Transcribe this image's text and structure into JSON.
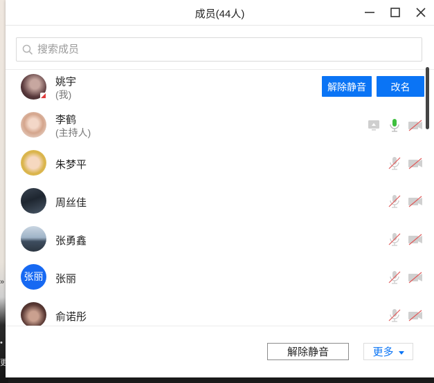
{
  "window": {
    "title": "成员(44人)",
    "controls": [
      "minimize-icon",
      "maximize-icon",
      "close-icon"
    ]
  },
  "search": {
    "placeholder": "搜索成员",
    "value": "",
    "icon": "search-icon"
  },
  "members": [
    {
      "name": "姚宇",
      "role": "(我)",
      "avatar": "photo",
      "actions": [
        "解除静音",
        "改名"
      ]
    },
    {
      "name": "李鹤",
      "role": "(主持人)",
      "avatar": "photo",
      "mic": "on",
      "camera": "off",
      "screen_share": true
    },
    {
      "name": "朱梦平",
      "avatar": "photo",
      "mic": "muted",
      "camera": "off"
    },
    {
      "name": "周丝佳",
      "avatar": "photo",
      "mic": "muted",
      "camera": "off"
    },
    {
      "name": "张勇鑫",
      "avatar": "photo",
      "mic": "muted",
      "camera": "off"
    },
    {
      "name": "张丽",
      "avatar_text": "张丽",
      "mic": "muted",
      "camera": "off"
    },
    {
      "name": "俞诺彤",
      "avatar": "photo",
      "mic": "muted",
      "camera": "off"
    }
  ],
  "footer": {
    "unmute_all_label": "解除静音",
    "more_label": "更多"
  },
  "colors": {
    "accent": "#0a74f5",
    "mic_active": "#3fbf3f",
    "muted_slash": "#e05a5a",
    "icon_gray": "#c8c8c8"
  }
}
